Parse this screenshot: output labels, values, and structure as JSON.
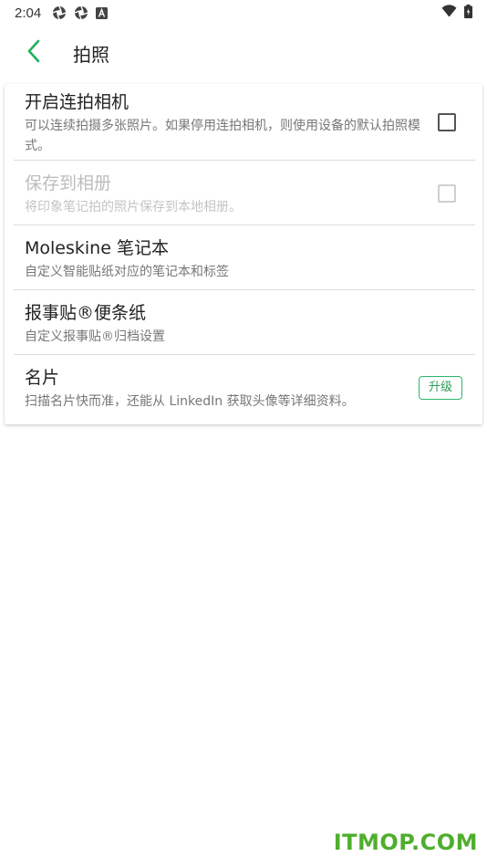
{
  "status_bar": {
    "time": "2:04",
    "icons": [
      "aperture-icon",
      "aperture-icon",
      "font-icon"
    ],
    "right_icons": [
      "wifi-icon",
      "battery-icon"
    ]
  },
  "app_bar": {
    "title": "拍照",
    "back_icon": "chevron-left-icon"
  },
  "settings": [
    {
      "title": "开启连拍相机",
      "subtitle": "可以连续拍摄多张照片。如果停用连拍相机，则使用设备的默认拍照模式。",
      "control": "checkbox",
      "checked": false,
      "enabled": true
    },
    {
      "title": "保存到相册",
      "subtitle": "将印象笔记拍的照片保存到本地相册。",
      "control": "checkbox",
      "checked": false,
      "enabled": false
    },
    {
      "title": "Moleskine 笔记本",
      "subtitle": "自定义智能贴纸对应的笔记本和标签",
      "control": "none",
      "enabled": true
    },
    {
      "title": "报事贴®便条纸",
      "subtitle": "自定义报事贴®归档设置",
      "control": "none",
      "enabled": true
    },
    {
      "title": "名片",
      "subtitle": "扫描名片快而准，还能从 LinkedIn 获取头像等详细资料。",
      "control": "badge",
      "badge_label": "升级",
      "enabled": true
    }
  ],
  "watermark": "ITMOP.COM",
  "colors": {
    "accent": "#1fb05a",
    "badge_text": "#2a9d57",
    "watermark": "#4fae2e",
    "disabled_text": "#bdbdbd"
  }
}
